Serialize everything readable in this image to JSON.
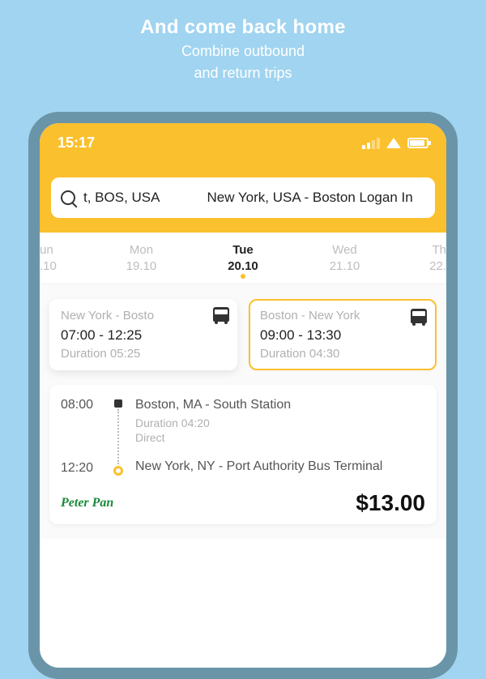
{
  "promo": {
    "title": "And come back home",
    "sub1": "Combine outbound",
    "sub2": "and return trips"
  },
  "status": {
    "time": "15:17"
  },
  "search": {
    "from": "t, BOS, USA",
    "to": "New York, USA - Boston Logan In"
  },
  "dates": [
    {
      "dow": "un",
      "dm": ".10",
      "edge": "l"
    },
    {
      "dow": "Mon",
      "dm": "19.10"
    },
    {
      "dow": "Tue",
      "dm": "20.10",
      "active": true
    },
    {
      "dow": "Wed",
      "dm": "21.10"
    },
    {
      "dow": "Th",
      "dm": "22.",
      "edge": "r"
    }
  ],
  "segments": {
    "out": {
      "route": "New York - Bosto",
      "times": "07:00 - 12:25",
      "duration": "Duration 05:25"
    },
    "ret": {
      "route": "Boston - New York",
      "times": "09:00 - 13:30",
      "duration": "Duration 04:30"
    }
  },
  "result": {
    "dep_time": "08:00",
    "arr_time": "12:20",
    "dep_stop": "Boston, MA - South Station",
    "dur": "Duration 04:20",
    "transfer": "Direct",
    "arr_stop": "New York, NY - Port Authority Bus Terminal",
    "carrier": "Peter Pan",
    "price": "$13.00"
  }
}
